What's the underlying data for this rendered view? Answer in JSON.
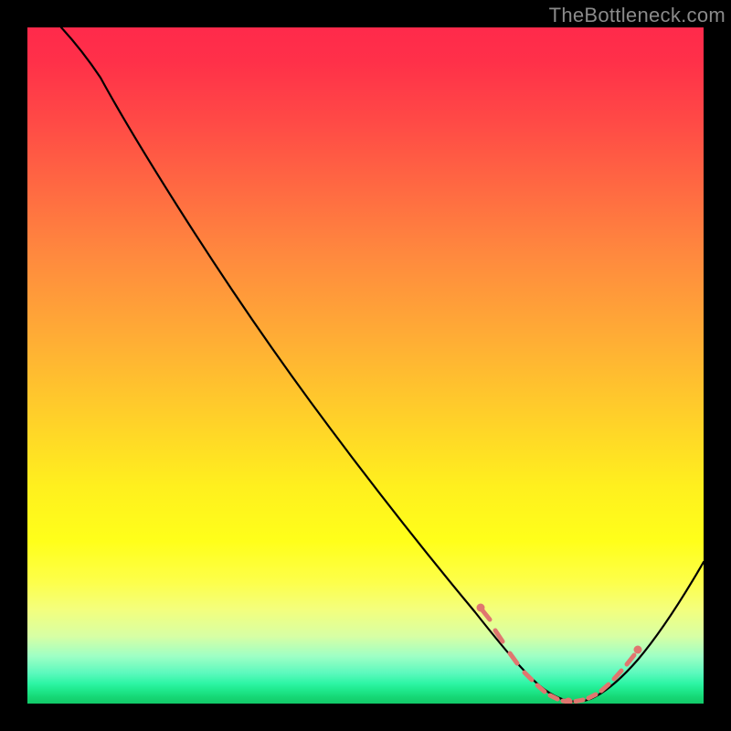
{
  "watermark": "TheBottleneck.com",
  "chart_data": {
    "type": "line",
    "title": "",
    "xlabel": "",
    "ylabel": "",
    "xlim": [
      0,
      100
    ],
    "ylim": [
      0,
      100
    ],
    "grid": false,
    "legend": false,
    "series": [
      {
        "name": "bottleneck-curve",
        "x": [
          5,
          8,
          12,
          20,
          30,
          40,
          50,
          60,
          67,
          70,
          73,
          76,
          79,
          82,
          85,
          88,
          91,
          94,
          97,
          100
        ],
        "y": [
          100,
          98,
          95,
          84,
          70,
          56,
          42,
          28,
          16,
          9,
          3.5,
          1,
          0.3,
          0.6,
          1.4,
          3.5,
          7,
          12,
          18,
          25
        ]
      }
    ],
    "markers": {
      "name": "highlight-dots",
      "color": "#e0766f",
      "x": [
        67,
        68.5,
        71,
        74,
        76.5,
        79,
        81,
        83,
        85,
        87,
        89,
        90.5
      ],
      "y": [
        16,
        13,
        7,
        2.5,
        1.0,
        0.3,
        0.5,
        0.9,
        1.6,
        3.0,
        5.0,
        6.5
      ]
    },
    "gradient_stops": [
      {
        "pct": 0,
        "color": "#ff2a4b"
      },
      {
        "pct": 24,
        "color": "#ff6a42"
      },
      {
        "pct": 58,
        "color": "#ffd129"
      },
      {
        "pct": 82,
        "color": "#f4ff7c"
      },
      {
        "pct": 97,
        "color": "#2ef5a5"
      },
      {
        "pct": 100,
        "color": "#12c968"
      }
    ]
  }
}
